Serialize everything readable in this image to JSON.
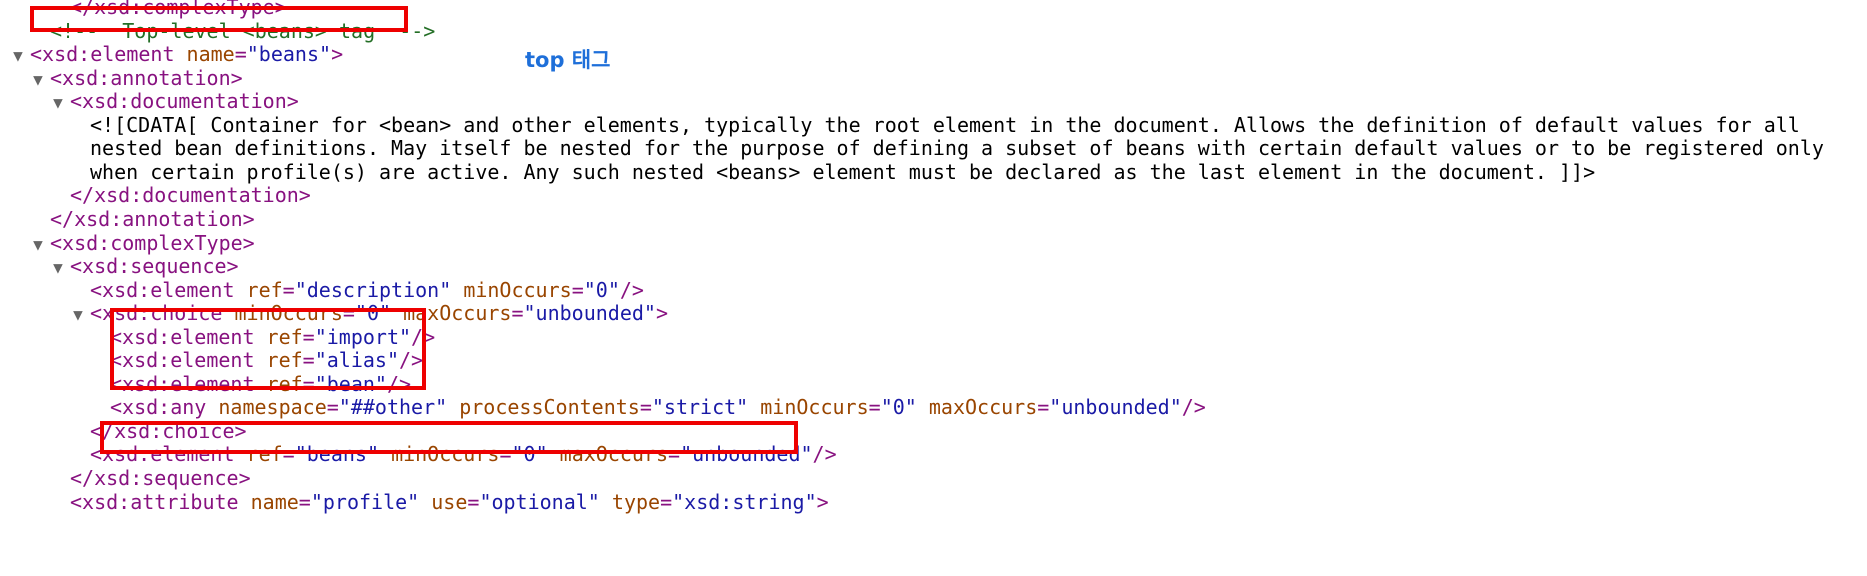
{
  "annotation": {
    "note": "top 태그"
  },
  "lines": [
    {
      "indent": 3,
      "toggle": "",
      "tokens": [
        {
          "c": "tag",
          "t": "</xsd:complexType>"
        }
      ]
    },
    {
      "indent": 2,
      "toggle": "",
      "tokens": [
        {
          "c": "cm",
          "t": "<!--  Top-level <beans> tag  -->"
        }
      ]
    },
    {
      "indent": 1,
      "toggle": "▼",
      "tokens": [
        {
          "c": "tag",
          "t": "<xsd:element "
        },
        {
          "c": "an",
          "t": "name"
        },
        {
          "c": "tag",
          "t": "="
        },
        {
          "c": "av",
          "t": "\"beans\""
        },
        {
          "c": "tag",
          "t": ">"
        }
      ]
    },
    {
      "indent": 2,
      "toggle": "▼",
      "tokens": [
        {
          "c": "tag",
          "t": "<xsd:annotation>"
        }
      ]
    },
    {
      "indent": 3,
      "toggle": "▼",
      "tokens": [
        {
          "c": "tag",
          "t": "<xsd:documentation>"
        }
      ]
    },
    {
      "indent": 4,
      "toggle": "",
      "tokens": [
        {
          "c": "tx",
          "t": "<![CDATA[ Container for <bean> and other elements, typically the root element in the document. Allows the definition of default values for all"
        }
      ]
    },
    {
      "indent": 4,
      "toggle": "",
      "tokens": [
        {
          "c": "tx",
          "t": "nested bean definitions. May itself be nested for the purpose of defining a subset of beans with certain default values or to be registered only"
        }
      ]
    },
    {
      "indent": 4,
      "toggle": "",
      "tokens": [
        {
          "c": "tx",
          "t": "when certain profile(s) are active. Any such nested <beans> element must be declared as the last element in the document. ]]>"
        }
      ]
    },
    {
      "indent": 3,
      "toggle": "",
      "tokens": [
        {
          "c": "tag",
          "t": "</xsd:documentation>"
        }
      ]
    },
    {
      "indent": 2,
      "toggle": "",
      "tokens": [
        {
          "c": "tag",
          "t": "</xsd:annotation>"
        }
      ]
    },
    {
      "indent": 2,
      "toggle": "▼",
      "tokens": [
        {
          "c": "tag",
          "t": "<xsd:complexType>"
        }
      ]
    },
    {
      "indent": 3,
      "toggle": "▼",
      "tokens": [
        {
          "c": "tag",
          "t": "<xsd:sequence>"
        }
      ]
    },
    {
      "indent": 4,
      "toggle": "",
      "tokens": [
        {
          "c": "tag",
          "t": "<xsd:element "
        },
        {
          "c": "an",
          "t": "ref"
        },
        {
          "c": "tag",
          "t": "="
        },
        {
          "c": "av",
          "t": "\"description\""
        },
        {
          "c": "tag",
          "t": " "
        },
        {
          "c": "an",
          "t": "minOccurs"
        },
        {
          "c": "tag",
          "t": "="
        },
        {
          "c": "av",
          "t": "\"0\""
        },
        {
          "c": "tag",
          "t": "/>"
        }
      ]
    },
    {
      "indent": 4,
      "toggle": "▼",
      "tokens": [
        {
          "c": "tag",
          "t": "<xsd:choice "
        },
        {
          "c": "an",
          "t": "minOccurs"
        },
        {
          "c": "tag",
          "t": "="
        },
        {
          "c": "av",
          "t": "\"0\""
        },
        {
          "c": "tag",
          "t": " "
        },
        {
          "c": "an",
          "t": "maxOccurs"
        },
        {
          "c": "tag",
          "t": "="
        },
        {
          "c": "av",
          "t": "\"unbounded\""
        },
        {
          "c": "tag",
          "t": ">"
        }
      ]
    },
    {
      "indent": 5,
      "toggle": "",
      "tokens": [
        {
          "c": "tag",
          "t": "<xsd:element "
        },
        {
          "c": "an",
          "t": "ref"
        },
        {
          "c": "tag",
          "t": "="
        },
        {
          "c": "av",
          "t": "\"import\""
        },
        {
          "c": "tag",
          "t": "/>"
        }
      ]
    },
    {
      "indent": 5,
      "toggle": "",
      "tokens": [
        {
          "c": "tag",
          "t": "<xsd:element "
        },
        {
          "c": "an",
          "t": "ref"
        },
        {
          "c": "tag",
          "t": "="
        },
        {
          "c": "av",
          "t": "\"alias\""
        },
        {
          "c": "tag",
          "t": "/>"
        }
      ]
    },
    {
      "indent": 5,
      "toggle": "",
      "tokens": [
        {
          "c": "tag",
          "t": "<xsd:element "
        },
        {
          "c": "an",
          "t": "ref"
        },
        {
          "c": "tag",
          "t": "="
        },
        {
          "c": "av",
          "t": "\"bean\""
        },
        {
          "c": "tag",
          "t": "/>"
        }
      ]
    },
    {
      "indent": 5,
      "toggle": "",
      "tokens": [
        {
          "c": "tag",
          "t": "<xsd:any "
        },
        {
          "c": "an",
          "t": "namespace"
        },
        {
          "c": "tag",
          "t": "="
        },
        {
          "c": "av",
          "t": "\"##other\""
        },
        {
          "c": "tag",
          "t": " "
        },
        {
          "c": "an",
          "t": "processContents"
        },
        {
          "c": "tag",
          "t": "="
        },
        {
          "c": "av",
          "t": "\"strict\""
        },
        {
          "c": "tag",
          "t": " "
        },
        {
          "c": "an",
          "t": "minOccurs"
        },
        {
          "c": "tag",
          "t": "="
        },
        {
          "c": "av",
          "t": "\"0\""
        },
        {
          "c": "tag",
          "t": " "
        },
        {
          "c": "an",
          "t": "maxOccurs"
        },
        {
          "c": "tag",
          "t": "="
        },
        {
          "c": "av",
          "t": "\"unbounded\""
        },
        {
          "c": "tag",
          "t": "/>"
        }
      ]
    },
    {
      "indent": 4,
      "toggle": "",
      "tokens": [
        {
          "c": "tag",
          "t": "</xsd:choice>"
        }
      ]
    },
    {
      "indent": 4,
      "toggle": "",
      "tokens": [
        {
          "c": "tag",
          "t": "<xsd:element "
        },
        {
          "c": "an",
          "t": "ref"
        },
        {
          "c": "tag",
          "t": "="
        },
        {
          "c": "av",
          "t": "\"beans\""
        },
        {
          "c": "tag",
          "t": " "
        },
        {
          "c": "an",
          "t": "minOccurs"
        },
        {
          "c": "tag",
          "t": "="
        },
        {
          "c": "av",
          "t": "\"0\""
        },
        {
          "c": "tag",
          "t": " "
        },
        {
          "c": "an",
          "t": "maxOccurs"
        },
        {
          "c": "tag",
          "t": "="
        },
        {
          "c": "av",
          "t": "\"unbounded\""
        },
        {
          "c": "tag",
          "t": "/>"
        }
      ]
    },
    {
      "indent": 3,
      "toggle": "",
      "tokens": [
        {
          "c": "tag",
          "t": "</xsd:sequence>"
        }
      ]
    },
    {
      "indent": 3,
      "toggle": "",
      "tokens": [
        {
          "c": "tag",
          "t": "<xsd:attribute "
        },
        {
          "c": "an",
          "t": "name"
        },
        {
          "c": "tag",
          "t": "="
        },
        {
          "c": "av",
          "t": "\"profile\""
        },
        {
          "c": "tag",
          "t": " "
        },
        {
          "c": "an",
          "t": "use"
        },
        {
          "c": "tag",
          "t": "="
        },
        {
          "c": "av",
          "t": "\"optional\""
        },
        {
          "c": "tag",
          "t": " "
        },
        {
          "c": "an",
          "t": "type"
        },
        {
          "c": "tag",
          "t": "="
        },
        {
          "c": "av",
          "t": "\"xsd:string\""
        },
        {
          "c": "tag",
          "t": ">"
        }
      ]
    }
  ]
}
